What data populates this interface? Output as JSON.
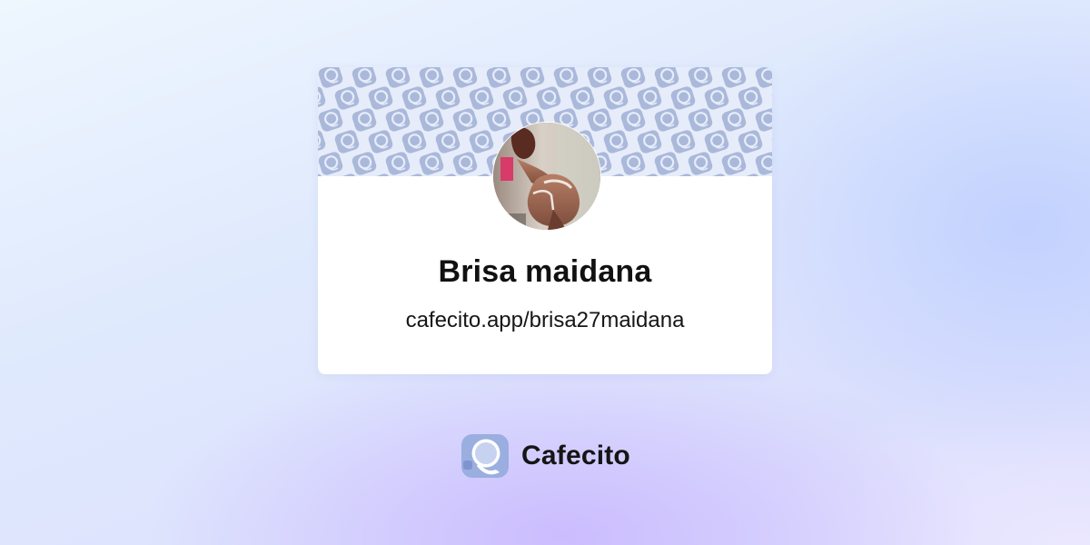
{
  "profile": {
    "name": "Brisa maidana",
    "url": "cafecito.app/brisa27maidana"
  },
  "brand": {
    "name": "Cafecito"
  },
  "icons": {
    "banner_pattern": "coffee-cup-icon",
    "logo": "cafecito-cup-logo-icon"
  },
  "colors": {
    "banner_background": "#e6ecf9",
    "banner_icon": "#aab8da",
    "logo_blue": "#9aaee0",
    "text": "#111111"
  }
}
